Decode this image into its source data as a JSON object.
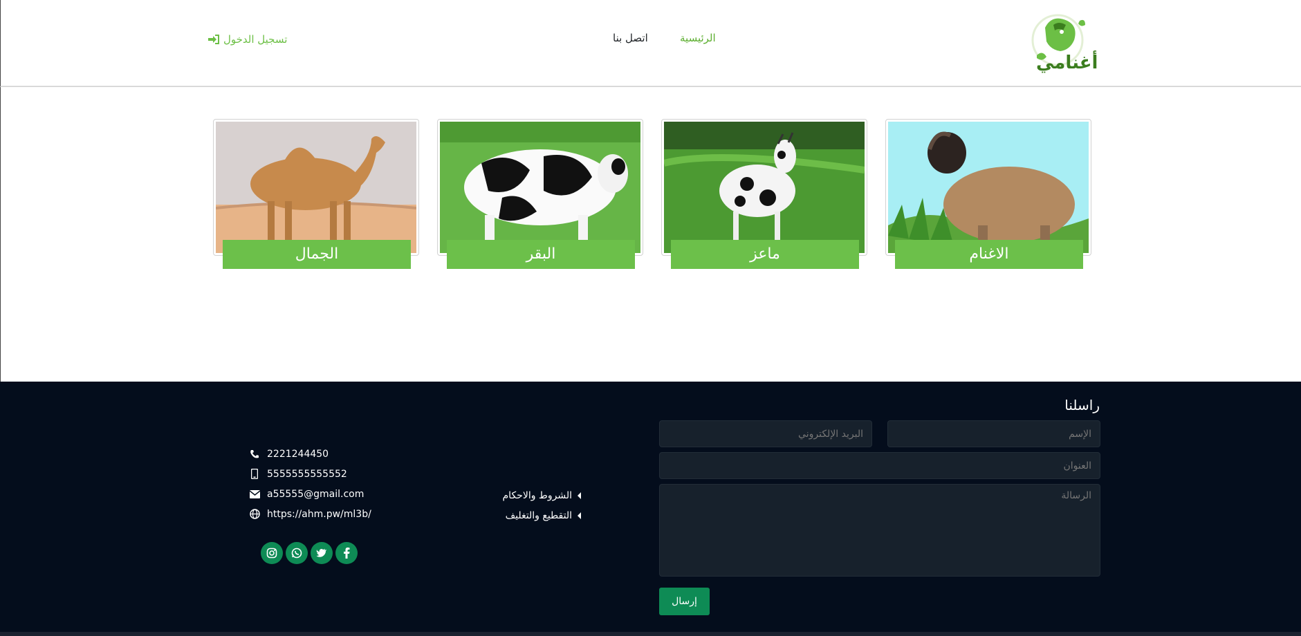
{
  "brand": {
    "name": "أغنامي"
  },
  "nav": {
    "home": "الرئيسية",
    "contact": "اتصل بنا",
    "login": "تسجيل الدخول"
  },
  "categories": [
    {
      "label": "الاغنام",
      "image": "sheep"
    },
    {
      "label": "ماعز",
      "image": "goat"
    },
    {
      "label": "البقر",
      "image": "cow"
    },
    {
      "label": "الجمال",
      "image": "camel"
    }
  ],
  "contact_form": {
    "title": "راسلنا",
    "name_placeholder": "الإسم",
    "email_placeholder": "البريد الإلكتروني",
    "subject_placeholder": "العنوان",
    "message_placeholder": "الرسالة",
    "send": "إرسال"
  },
  "footer_links": [
    {
      "label": "الشروط والاحكام"
    },
    {
      "label": "التقطيع والتغليف"
    }
  ],
  "contact_info": {
    "phone": "2221244450",
    "mobile": "5555555555552",
    "email": "a55555@gmail.com",
    "website": "https://ahm.pw/ml3b/"
  },
  "social": [
    "facebook-icon",
    "twitter-icon",
    "whatsapp-icon",
    "instagram-icon"
  ],
  "colors": {
    "accent": "#6cc04a",
    "footer_bg": "#040d1c",
    "button": "#0e8b55"
  }
}
